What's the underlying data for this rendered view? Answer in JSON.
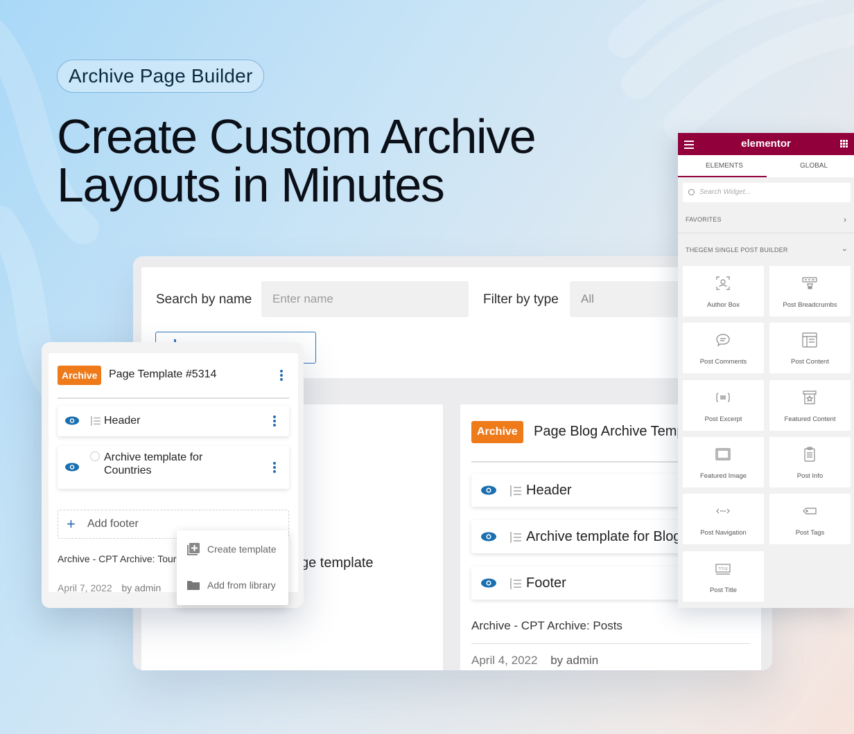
{
  "hero": {
    "pill": "Archive Page Builder",
    "headline_line1": "Create Custom Archive",
    "headline_line2": "Layouts in Minutes"
  },
  "colors": {
    "archive_badge": "#ee7a1a",
    "accent_blue": "#2a6bb0",
    "elementor_brand": "#92003b"
  },
  "filters": {
    "search_label": "Search by name",
    "search_placeholder": "Enter name",
    "type_label": "Filter by type",
    "type_value": "All"
  },
  "left_card_fragment": "ge template",
  "right_card": {
    "badge": "Archive",
    "title": "Page Blog Archive Temp",
    "rows": [
      {
        "label": "Header",
        "icon": "eye-icon"
      },
      {
        "label": "Archive template for Blog",
        "icon": "eye-icon"
      },
      {
        "label": "Footer",
        "icon": "eye-icon"
      }
    ],
    "type_line": "Archive - CPT Archive: Posts",
    "date": "April 4, 2022",
    "author": "by admin"
  },
  "float_card": {
    "badge": "Archive",
    "title": "Page Template #5314",
    "rows": [
      {
        "label": "Header"
      },
      {
        "label_1": "Archive template for",
        "label_2": "Countries"
      }
    ],
    "add_footer": "Add footer",
    "type_line": "Archive - CPT Archive: Tour",
    "date": "April 7, 2022",
    "author": "by admin"
  },
  "popup_menu": {
    "items": [
      "Create template",
      "Add from library"
    ]
  },
  "elementor": {
    "logo": "elementor",
    "tabs": [
      "ELEMENTS",
      "GLOBAL"
    ],
    "search_placeholder": "Search Widget...",
    "favorites": "FAVORITES",
    "section": "THEGEM SINGLE POST BUILDER",
    "widgets": [
      "Author Box",
      "Post Breadcrumbs",
      "Post Comments",
      "Post Content",
      "Post Excerpt",
      "Featured Content",
      "Featured Image",
      "Post Info",
      "Post Navigation",
      "Post Tags",
      "Post Title"
    ]
  }
}
